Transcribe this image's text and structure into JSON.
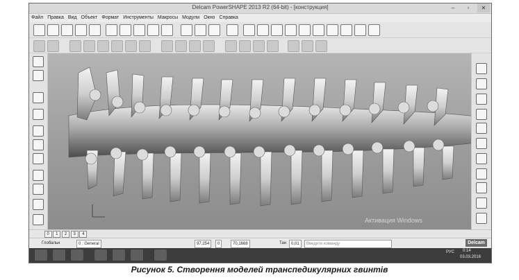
{
  "window": {
    "title": "Delcam PowerSHAPE 2013 R2 (64-bit) - [конструкция]",
    "controls": [
      "–",
      "▫",
      "✕"
    ]
  },
  "menu": [
    "Файл",
    "Правка",
    "Вид",
    "Объект",
    "Формат",
    "Инструменты",
    "Макросы",
    "Модули",
    "Окно",
    "Справка"
  ],
  "layers": {
    "items": [
      "0",
      "1",
      "2",
      "3",
      "4"
    ]
  },
  "status": {
    "level_label": "Глобальн",
    "workplane": "0 : General",
    "x_value": "97,254",
    "y_value": "0",
    "z_value": "70,1668",
    "tol_label": "Тан",
    "tol_value": "0,01",
    "command_placeholder": "Введите команду",
    "brand": "Delcam"
  },
  "watermark": {
    "title": "Активация Windows"
  },
  "taskbar": {
    "lang": "РУС",
    "time": "0:14",
    "date": "03.03.2016"
  },
  "caption": "Рисунок 5. Створення моделей транспедикулярних гвинтів"
}
